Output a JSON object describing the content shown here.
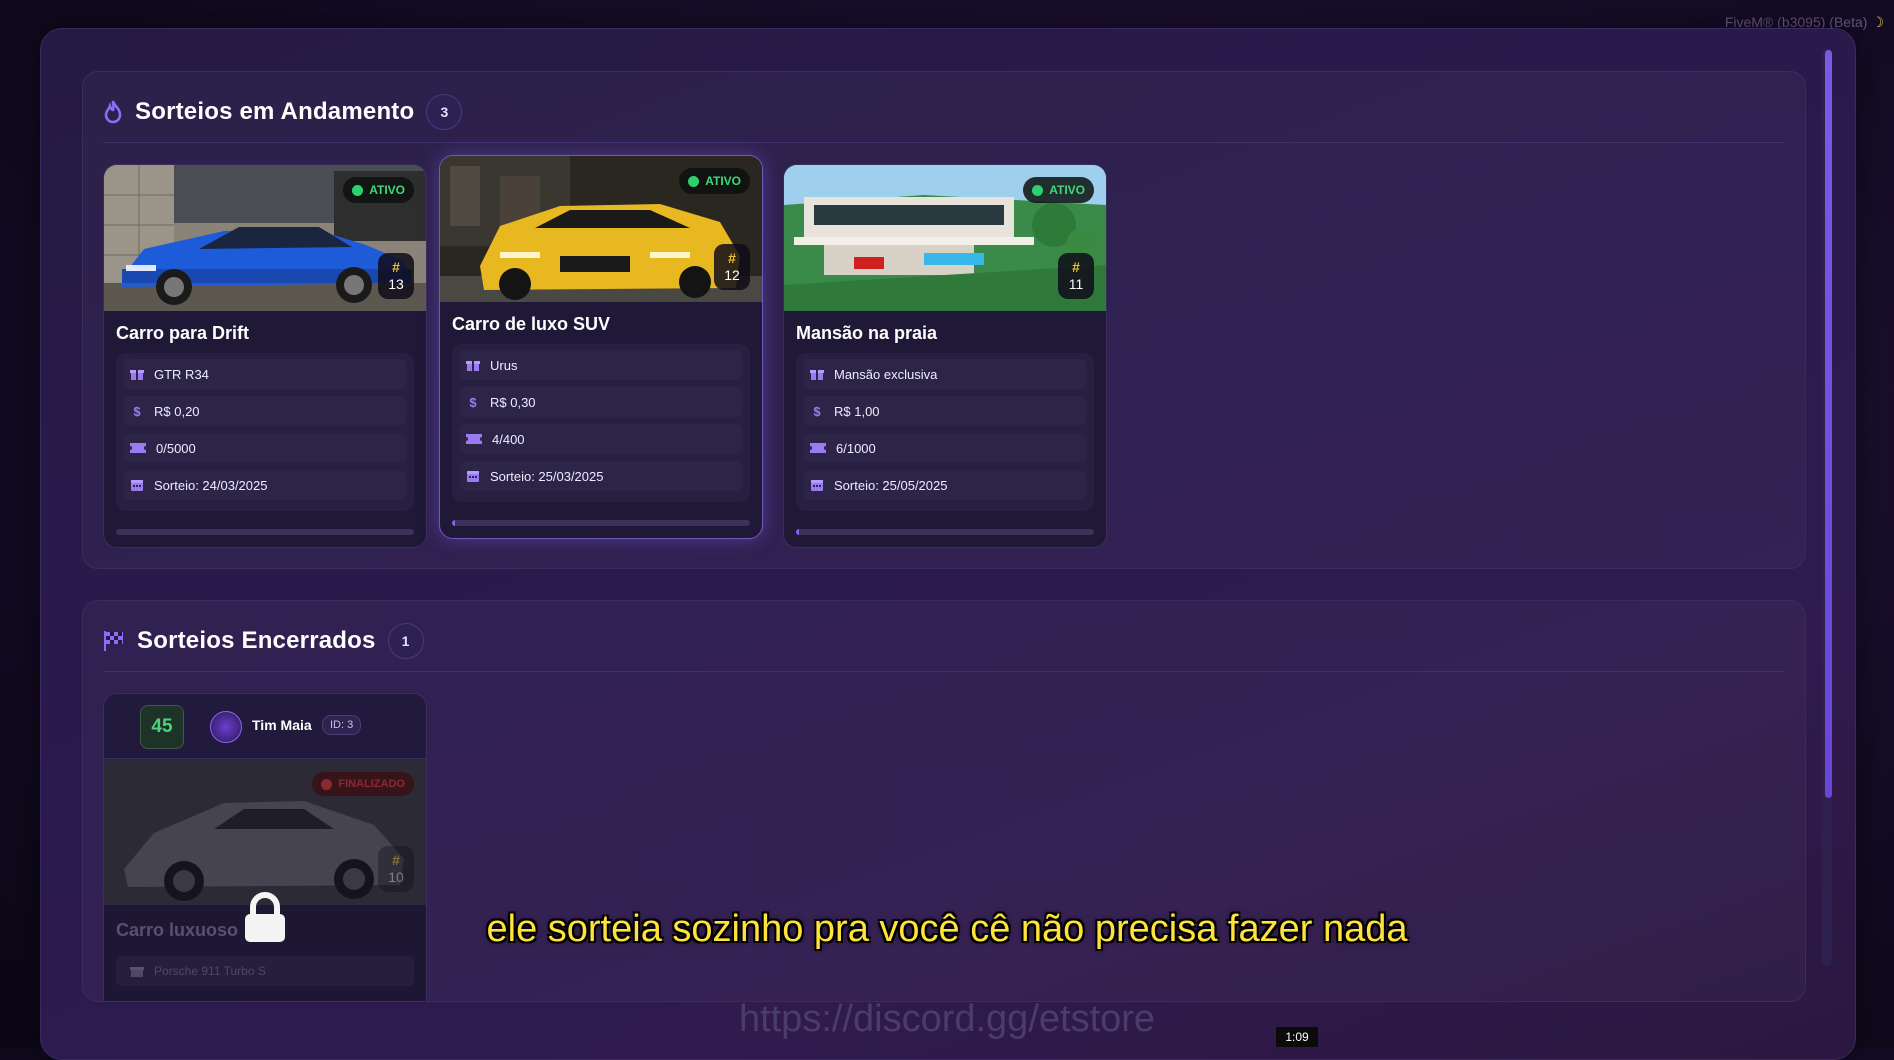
{
  "window": {
    "title": "FiveM® (b3095) (Beta)"
  },
  "active_section": {
    "title": "Sorteios em Andamento",
    "count": "3",
    "cards": [
      {
        "title": "Carro para Drift",
        "status": "ATIVO",
        "number": "13",
        "prize": "GTR R34",
        "price": "R$ 0,20",
        "tickets": "0/5000",
        "draw_date": "Sorteio: 24/03/2025",
        "progress": 0.0
      },
      {
        "title": "Carro de luxo SUV",
        "status": "ATIVO",
        "number": "12",
        "prize": "Urus",
        "price": "R$ 0,30",
        "tickets": "4/400",
        "draw_date": "Sorteio: 25/03/2025",
        "progress": 0.01
      },
      {
        "title": "Mansão na praia",
        "status": "ATIVO",
        "number": "11",
        "prize": "Mansão exclusiva",
        "price": "R$ 1,00",
        "tickets": "6/1000",
        "draw_date": "Sorteio: 25/05/2025",
        "progress": 0.006
      }
    ]
  },
  "closed_section": {
    "title": "Sorteios Encerrados",
    "count": "1",
    "cards": [
      {
        "winner_ticket": "45",
        "winner_name": "Tim Maia",
        "winner_id": "ID: 3",
        "status": "FINALIZADO",
        "number": "10",
        "title": "Carro luxuoso",
        "prize": "Porsche 911 Turbo S"
      }
    ]
  },
  "overlay": {
    "subtitle": "ele sorteia sozinho pra você cê não precisa fazer nada",
    "url": "https://discord.gg/etstore",
    "timecode": "1:09"
  },
  "colors": {
    "accent": "#7e62f0",
    "active": "#2fd16e",
    "finished": "#8a2a32",
    "subtitle": "#ffe23a"
  }
}
